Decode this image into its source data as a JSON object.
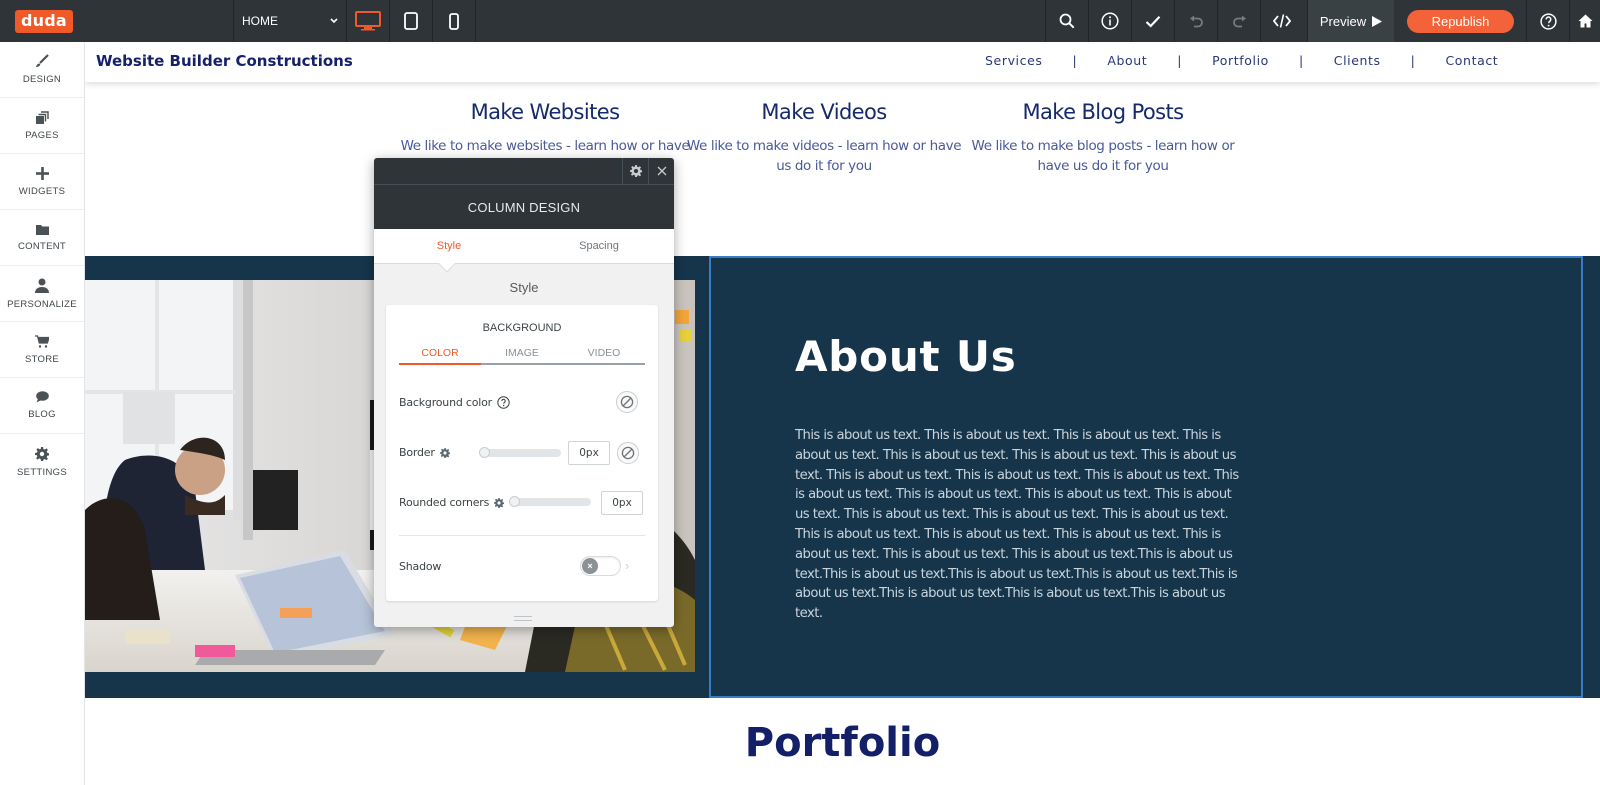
{
  "toolbar": {
    "logo": "duda",
    "page_select": "HOME",
    "devices": [
      {
        "name": "desktop",
        "active": true
      },
      {
        "name": "tablet",
        "active": false
      },
      {
        "name": "mobile",
        "active": false
      }
    ],
    "preview_label": "Preview",
    "republish_label": "Republish",
    "accent_color": "#f05a28"
  },
  "sidebar": {
    "items": [
      {
        "label": "DESIGN",
        "icon": "brush-icon"
      },
      {
        "label": "PAGES",
        "icon": "pages-icon"
      },
      {
        "label": "WIDGETS",
        "icon": "plus-icon"
      },
      {
        "label": "CONTENT",
        "icon": "folder-icon"
      },
      {
        "label": "PERSONALIZE",
        "icon": "user-icon"
      },
      {
        "label": "STORE",
        "icon": "cart-icon"
      },
      {
        "label": "BLOG",
        "icon": "chat-icon"
      },
      {
        "label": "SETTINGS",
        "icon": "gear-icon"
      }
    ]
  },
  "site": {
    "title": "Website Builder Constructions",
    "nav": [
      "Services",
      "About",
      "Portfolio",
      "Clients",
      "Contact"
    ],
    "nav_separator": "|",
    "services": [
      {
        "title": "Make Websites",
        "text": "We like to make websites - learn how or have us do it for you"
      },
      {
        "title": "Make Videos",
        "text": "We like to make videos - learn how or have us do it for you"
      },
      {
        "title": "Make Blog Posts",
        "text": "We like to make blog posts - learn how or have us do it for you"
      }
    ],
    "about": {
      "heading": "About Us",
      "text": "This is about us text. This is about us text. This is about us text. This is about us text. This is about us text. This is about us text. This is about us text. This is about us text. This is about us text. This is about us text. This is about us text. This is about us text. This is about us text. This is about us text. This is about us text. This is about us text. This is about us text. This is about us text. This is about us text. This is about us text. This is about us text. This is about us text. This is about us text.This is about us text.This is about us text.This is about us text.This is about us text.This is about us text.This is about us text.This is about us text.This is about us text.",
      "bg_color": "#16354b"
    },
    "portfolio_heading": "Portfolio"
  },
  "panel": {
    "title": "COLUMN DESIGN",
    "tabs": [
      {
        "label": "Style",
        "active": true
      },
      {
        "label": "Spacing",
        "active": false
      }
    ],
    "section_label": "Style",
    "background": {
      "title": "BACKGROUND",
      "tabs": [
        {
          "label": "COLOR",
          "active": true
        },
        {
          "label": "IMAGE",
          "active": false
        },
        {
          "label": "VIDEO",
          "active": false
        }
      ],
      "bg_color_label": "Background color",
      "border_label": "Border",
      "border_value": "0px",
      "rounded_label": "Rounded corners",
      "rounded_value": "0px",
      "shadow_label": "Shadow",
      "shadow_enabled": false
    }
  }
}
